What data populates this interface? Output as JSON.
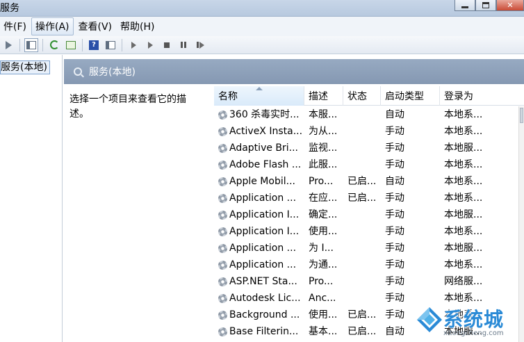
{
  "window": {
    "title": "服务"
  },
  "menu": {
    "items": [
      {
        "label": "件(F)"
      },
      {
        "label": "操作(A)"
      },
      {
        "label": "查看(V)"
      },
      {
        "label": "帮助(H)"
      }
    ]
  },
  "tree": {
    "selected": "服务(本地)"
  },
  "panel": {
    "header": "服务(本地)",
    "description": "选择一个项目来查看它的描述。"
  },
  "table": {
    "columns": [
      "名称",
      "描述",
      "状态",
      "启动类型",
      "登录为"
    ],
    "rows": [
      {
        "name": "360 杀毒实时...",
        "desc": "本服...",
        "status": "",
        "start": "自动",
        "logon": "本地系..."
      },
      {
        "name": "ActiveX Insta...",
        "desc": "为从...",
        "status": "",
        "start": "手动",
        "logon": "本地系..."
      },
      {
        "name": "Adaptive Bri...",
        "desc": "监视...",
        "status": "",
        "start": "手动",
        "logon": "本地服..."
      },
      {
        "name": "Adobe Flash ...",
        "desc": "此服...",
        "status": "",
        "start": "手动",
        "logon": "本地系..."
      },
      {
        "name": "Apple Mobil...",
        "desc": "Pro...",
        "status": "已启...",
        "start": "自动",
        "logon": "本地系..."
      },
      {
        "name": "Application ...",
        "desc": "在应...",
        "status": "已启...",
        "start": "手动",
        "logon": "本地系..."
      },
      {
        "name": "Application I...",
        "desc": "确定...",
        "status": "",
        "start": "手动",
        "logon": "本地服..."
      },
      {
        "name": "Application I...",
        "desc": "使用...",
        "status": "",
        "start": "手动",
        "logon": "本地系..."
      },
      {
        "name": "Application ...",
        "desc": "为 I...",
        "status": "",
        "start": "手动",
        "logon": "本地服..."
      },
      {
        "name": "Application ...",
        "desc": "为通...",
        "status": "",
        "start": "手动",
        "logon": "本地系..."
      },
      {
        "name": "ASP.NET Sta...",
        "desc": "Pro...",
        "status": "",
        "start": "手动",
        "logon": "网络服..."
      },
      {
        "name": "Autodesk Lic...",
        "desc": "Anc...",
        "status": "",
        "start": "手动",
        "logon": "本地系..."
      },
      {
        "name": "Background ...",
        "desc": "使用...",
        "status": "已启...",
        "start": "手动",
        "logon": "本地系..."
      },
      {
        "name": "Base Filterin...",
        "desc": "基本...",
        "status": "已启...",
        "start": "自动",
        "logon": "本地服..."
      }
    ]
  },
  "watermark": {
    "text": "系统城",
    "url": "xitongcheng.com"
  },
  "colors": {
    "header_bg": "#8fa2bb",
    "selection_bg": "#e8f0fa",
    "watermark": "#2a8ad6"
  }
}
